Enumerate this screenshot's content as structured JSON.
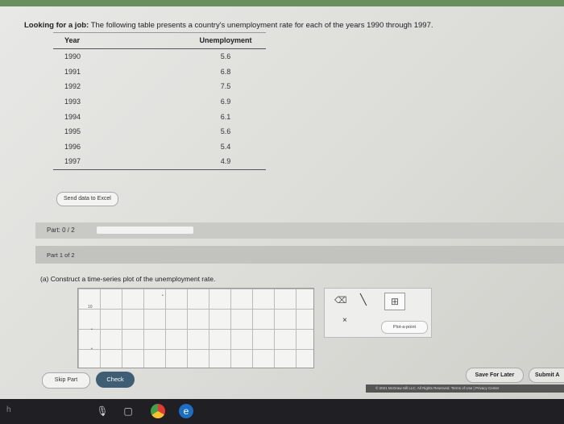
{
  "problem": {
    "lead": "Looking for a job:",
    "text": "The following table presents a country's unemployment rate for each of the years 1990 through 1997."
  },
  "table": {
    "headers": [
      "Year",
      "Unemployment"
    ],
    "rows": [
      [
        "1990",
        "5.6"
      ],
      [
        "1991",
        "6.8"
      ],
      [
        "1992",
        "7.5"
      ],
      [
        "1993",
        "6.9"
      ],
      [
        "1994",
        "6.1"
      ],
      [
        "1995",
        "5.6"
      ],
      [
        "1996",
        "5.4"
      ],
      [
        "1997",
        "4.9"
      ]
    ]
  },
  "excel_button": "Send data to Excel",
  "part_progress": {
    "label": "Part: 0 / 2",
    "fraction": 0.0
  },
  "part_header": "Part 1 of 2",
  "question": "(a) Construct a time-series plot of the unemployment rate.",
  "plot": {
    "y_ticks": [
      "10",
      "",
      ""
    ]
  },
  "tools": {
    "eraser_icon": "eraser-icon",
    "line_icon": "line-tool-icon",
    "grid_icon": "grid-tool-icon",
    "close_label": "×",
    "pin_label": "Plot-a-point"
  },
  "buttons": {
    "skip": "Skip Part",
    "check": "Check",
    "save": "Save For Later",
    "submit": "Submit A"
  },
  "footer": "© 2021 McGraw Hill LLC. All Rights Reserved.   Terms of Use  |  Privacy Center",
  "colors": {
    "check_button": "#3f5e74",
    "top_bar": "#6a8f5e",
    "taskbar": "#1f1f24"
  }
}
